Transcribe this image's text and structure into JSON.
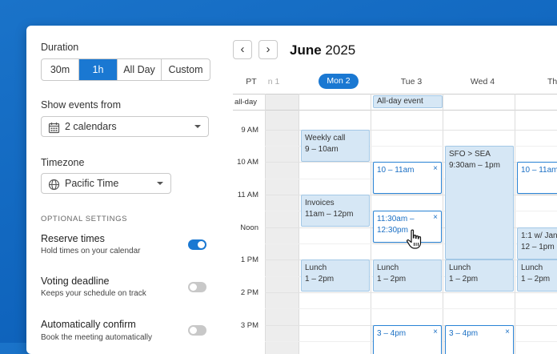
{
  "duration": {
    "label": "Duration",
    "options": [
      "30m",
      "1h",
      "All Day",
      "Custom"
    ],
    "selected": "1h"
  },
  "show_events": {
    "label": "Show events from",
    "value": "2 calendars",
    "icon": "calendar-icon"
  },
  "timezone": {
    "label": "Timezone",
    "value": "Pacific Time",
    "icon": "globe-icon"
  },
  "optional_settings": {
    "heading": "OPTIONAL SETTINGS",
    "items": [
      {
        "title": "Reserve times",
        "subtitle": "Hold times on your calendar",
        "enabled": true
      },
      {
        "title": "Voting deadline",
        "subtitle": "Keeps your schedule on track",
        "enabled": false
      },
      {
        "title": "Automatically confirm",
        "subtitle": "Book the meeting automatically",
        "enabled": false
      }
    ]
  },
  "calendar": {
    "prev_label": "‹",
    "next_label": "›",
    "month": "June",
    "year": "2025",
    "timezone_short": "PT",
    "partial_day": "n 1",
    "days": [
      "Mon 2",
      "Tue 3",
      "Wed 4",
      "Thu"
    ],
    "today": "Mon 2",
    "allday_label": "all-day",
    "allday_event": "All-day event",
    "times": [
      "9 AM",
      "10 AM",
      "11 AM",
      "Noon",
      "1 PM",
      "2 PM",
      "3 PM"
    ],
    "events": {
      "weekly_call": {
        "title": "Weekly call",
        "time": "9 – 10am"
      },
      "invoices": {
        "title": "Invoices",
        "time": "11am – 12pm"
      },
      "lunch_mon": {
        "title": "Lunch",
        "time": "1 – 2pm"
      },
      "lunch_tue": {
        "title": "Lunch",
        "time": "1 – 2pm"
      },
      "lunch_wed": {
        "title": "Lunch",
        "time": "1 – 2pm"
      },
      "lunch_thu": {
        "title": "Lunch",
        "time": "1 – 2pm"
      },
      "flight": {
        "title": "SFO > SEA",
        "time": "9:30am – 1pm"
      },
      "thu_meeting": {
        "title": "1:1 w/ Jan",
        "time": "12 – 1pm"
      }
    },
    "slots": {
      "tue_10": "10 – 11am",
      "tue_1130": "11:30am – 12:30pm",
      "thu_10": "10 – 11am",
      "tue_3": "3 – 4pm",
      "wed_3": "3 – 4pm"
    },
    "close_glyph": "×"
  },
  "colors": {
    "accent": "#1a78d2",
    "event_bg": "#d6e7f5",
    "background": "#0f64bd"
  }
}
